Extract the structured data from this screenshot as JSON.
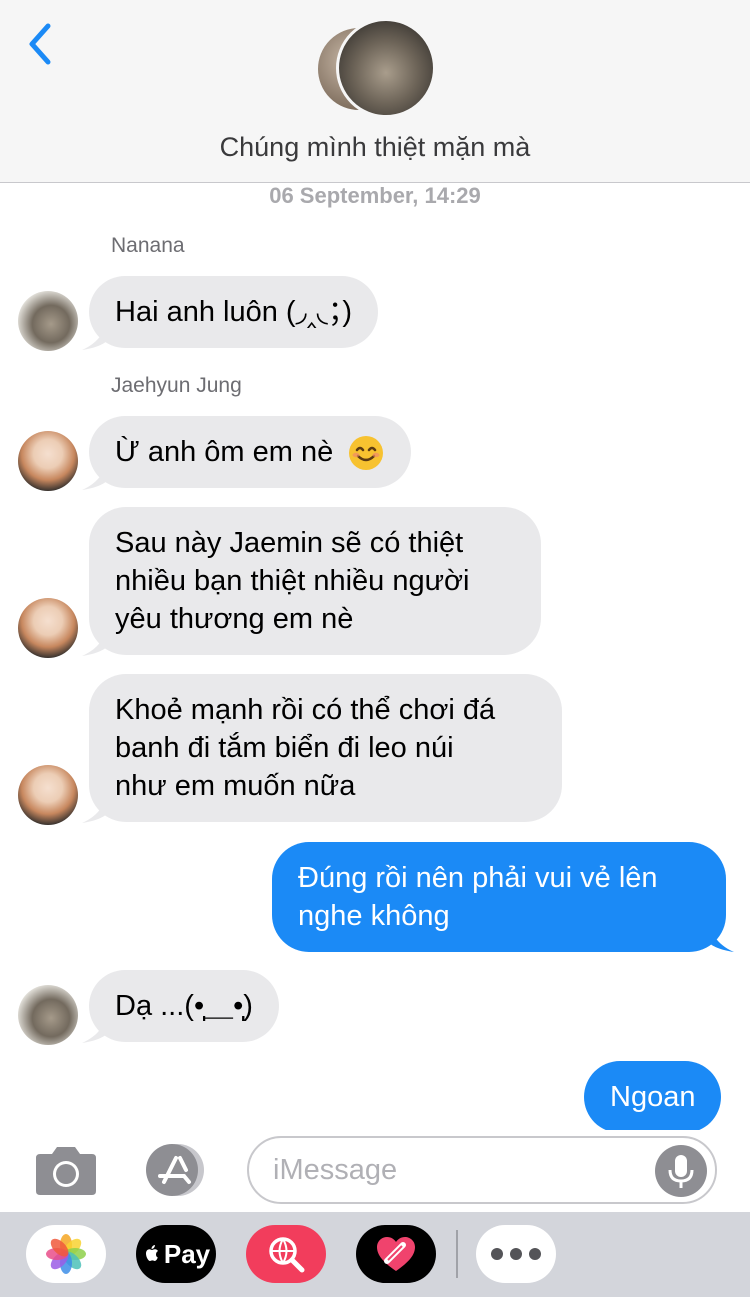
{
  "header": {
    "back_icon": "chevron-left-icon",
    "title": "Chúng mình thiệt mặn mà",
    "accent": "#1b8af6"
  },
  "timestamp": "06 September, 14:29",
  "messages": [
    {
      "sender": "Nanana",
      "direction": "incoming",
      "text": "Hai anh luôn (◞‸◟；)"
    },
    {
      "sender": "Jaehyun Jung",
      "direction": "incoming",
      "text": "Ừ anh ôm em nè",
      "emoji": "smiling-face-icon"
    },
    {
      "direction": "incoming",
      "lines": [
        "Sau này Jaemin sẽ có thiệt",
        "nhiều bạn thiệt nhiều người",
        "yêu thương em nè"
      ]
    },
    {
      "direction": "incoming",
      "lines": [
        "Khoẻ mạnh rồi có thể chơi đá",
        "banh đi tắm biển đi leo núi",
        "như em muốn nữa"
      ]
    },
    {
      "direction": "outgoing",
      "lines": [
        "Đúng rồi nên phải vui vẻ lên",
        "nghe không"
      ]
    },
    {
      "direction": "incoming",
      "text": "Dạ ...(•̩̩̩̩＿•̩̩̩̩)"
    },
    {
      "direction": "outgoing",
      "text": "Ngoan"
    }
  ],
  "input": {
    "placeholder": "iMessage",
    "value": ""
  },
  "drawer": {
    "apps": [
      "photos-icon",
      "apple-pay-icon",
      "web-search-icon",
      "digital-touch-icon",
      "more-icon"
    ],
    "pay_label": "Pay"
  },
  "colors": {
    "incoming_bubble": "#e9e9eb",
    "outgoing_bubble": "#1b8af6"
  }
}
